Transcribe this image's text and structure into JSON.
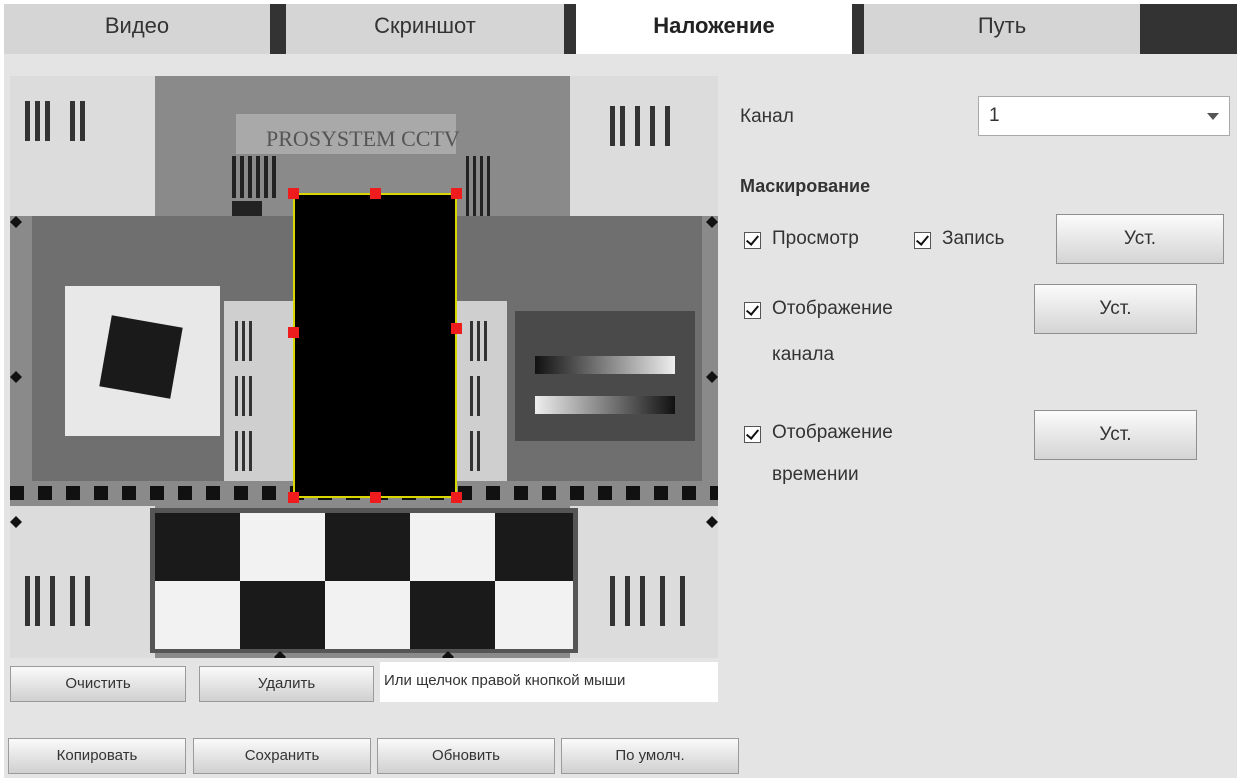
{
  "tabs": [
    {
      "label": "Видео"
    },
    {
      "label": "Скриншот"
    },
    {
      "label": "Наложение"
    },
    {
      "label": "Путь"
    }
  ],
  "preview": {
    "overlay_text": "PROSYSTEM CCTV"
  },
  "hint": "Или щелчок правой кнопкой мыши",
  "buttons": {
    "clear": "Очистить",
    "delete": "Удалить",
    "copy": "Копировать",
    "save": "Сохранить",
    "refresh": "Обновить",
    "default": "По умолч."
  },
  "settings": {
    "channel_label": "Канал",
    "channel_value": "1",
    "masking_title": "Маскирование",
    "preview_label": "Просмотр",
    "record_label": "Запись",
    "channel_display_line1": "Отображение",
    "channel_display_line2": "канала",
    "time_display_line1": "Отображение",
    "time_display_line2": "времении",
    "set_label": "Уст."
  },
  "colors": {
    "mask_handle": "#ee1c1c",
    "mask_border": "#d9d600"
  }
}
